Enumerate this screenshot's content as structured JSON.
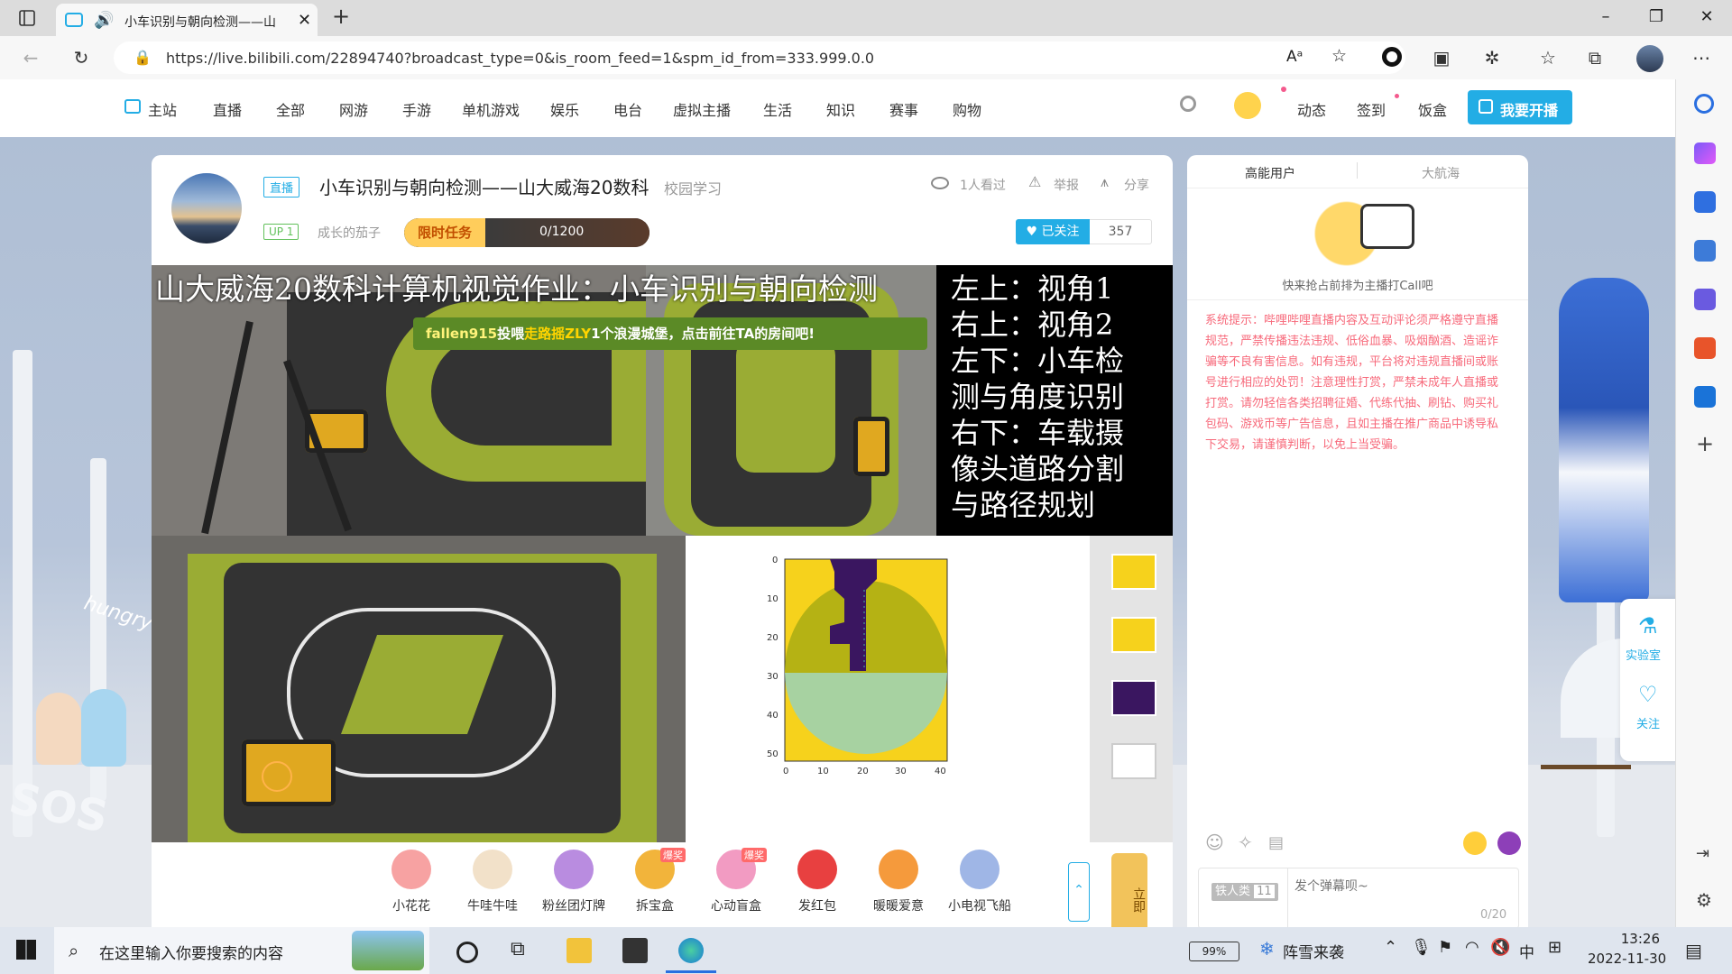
{
  "browser": {
    "tab_title": "小车识别与朝向检测——山",
    "url": "https://live.bilibili.com/22894740?broadcast_type=0&is_room_feed=1&spm_id_from=333.999.0.0"
  },
  "nav": {
    "items": [
      "主站",
      "直播",
      "全部",
      "网游",
      "手游",
      "单机游戏",
      "娱乐",
      "电台",
      "虚拟主播",
      "生活",
      "知识",
      "赛事",
      "购物"
    ],
    "right_items": [
      "动态",
      "签到",
      "饭盒"
    ],
    "open_live_label": "我要开播"
  },
  "room": {
    "live_badge": "直播",
    "title": "小车识别与朝向检测——山大威海20数科",
    "category": "校园学习",
    "viewers": "1人看过",
    "report": "举报",
    "share": "分享",
    "level_badge": "UP 1",
    "streamer_name": "成长的茄子",
    "task_label": "限时任务",
    "task_progress": "0/1200",
    "task_progress_value": 0,
    "follow_label": "已关注",
    "follow_count": "357"
  },
  "video": {
    "overlay_title": "山大威海20数科计算机视觉作业：小车识别与朝向检测",
    "legend_lines": [
      "左上：视角1",
      "右上：视角2",
      "左下：小车检",
      "测与角度识别",
      "右下：车载摄",
      "像头道路分割",
      "与路径规划"
    ],
    "gift_banner": {
      "user": "fallen915",
      "verb": "投喂",
      "target": "走路摇ZLY",
      "rest": "1个浪漫城堡，点击前往TA的房间吧!"
    },
    "plot_y_ticks": [
      "0",
      "10",
      "20",
      "30",
      "40",
      "50"
    ],
    "plot_x_ticks": [
      "0",
      "10",
      "20",
      "30",
      "40"
    ]
  },
  "gifts": [
    {
      "name": "小花花",
      "color": "#f7a2a2",
      "tag": ""
    },
    {
      "name": "牛哇牛哇",
      "color": "#f2e1c9",
      "tag": ""
    },
    {
      "name": "粉丝团灯牌",
      "color": "#b98ce0",
      "tag": ""
    },
    {
      "name": "拆宝盒",
      "color": "#f2b43b",
      "tag": "爆奖"
    },
    {
      "name": "心动盲盒",
      "color": "#f29bc2",
      "tag": "爆奖"
    },
    {
      "name": "发红包",
      "color": "#e84040",
      "tag": ""
    },
    {
      "name": "暖暖爱意",
      "color": "#f59a3c",
      "tag": ""
    },
    {
      "name": "小电视飞船",
      "color": "#9fb6e6",
      "tag": ""
    }
  ],
  "gift_more_label": "立即",
  "chat": {
    "tab_high": "高能用户",
    "tab_voyage": "大航海",
    "empty_tip": "快来抢占前排为主播打Call吧",
    "system_msg": "系统提示：哔哩哔哩直播内容及互动评论须严格遵守直播规范，严禁传播违法违规、低俗血暴、吸烟酗酒、造谣诈骗等不良有害信息。如有违规，平台将对违规直播间或账号进行相应的处罚！注意理性打赏，严禁未成年人直播或打赏。请勿轻信各类招聘征婚、代练代抽、刷钻、购买礼包码、游戏币等广告信息，且如主播在推广商品中诱导私下交易，请谨慎判断，以免上当受骗。",
    "fan_badge": "铁人类",
    "fan_level": "11",
    "input_placeholder": "发个弹幕呗~",
    "char_count": "0/20"
  },
  "float_widget": {
    "lab": "实验室",
    "follow": "关注"
  },
  "decor": {
    "hungry": "hungry",
    "sos": "SOS"
  },
  "taskbar": {
    "search_placeholder": "在这里输入你要搜索的内容",
    "battery": "99%",
    "weather": "阵雪来袭",
    "ime": "中",
    "time": "13:26",
    "date": "2022-11-30"
  }
}
